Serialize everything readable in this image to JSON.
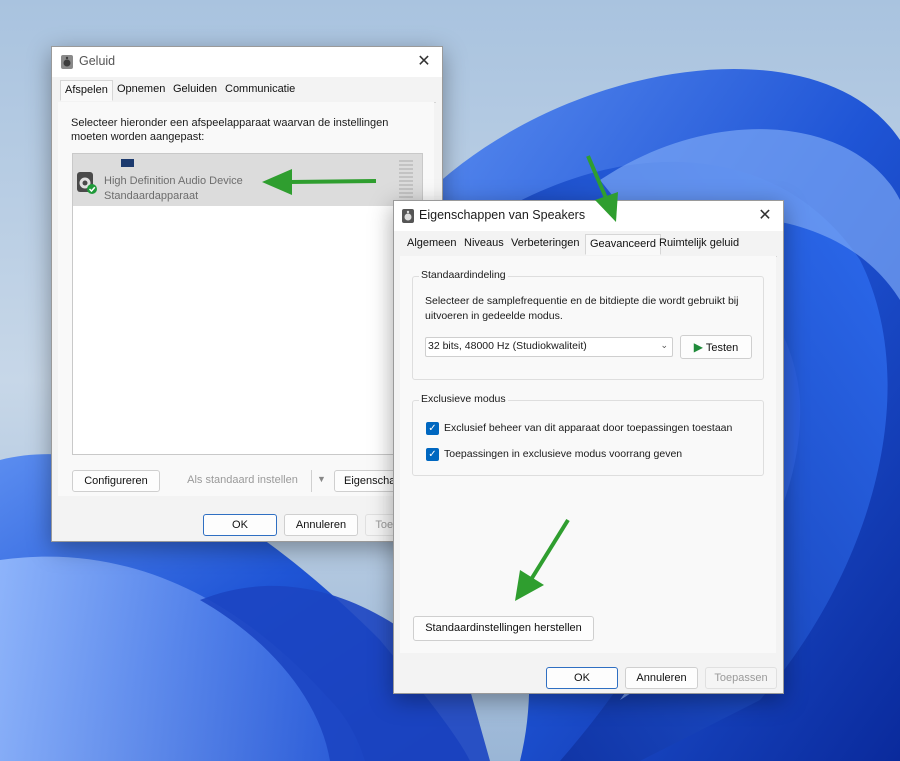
{
  "sound_dialog": {
    "title": "Geluid",
    "tabs": [
      "Afspelen",
      "Opnemen",
      "Geluiden",
      "Communicatie"
    ],
    "instruction": "Selecteer hieronder een afspeelapparaat waarvan de instellingen moeten worden aangepast:",
    "device": {
      "name": "High Definition Audio Device",
      "status": "Standaardapparaat"
    },
    "buttons": {
      "configure": "Configureren",
      "set_default": "Als standaard instellen",
      "properties": "Eigenschappen"
    },
    "footer": {
      "ok": "OK",
      "cancel": "Annuleren",
      "apply": "Toepassen"
    }
  },
  "speaker_dialog": {
    "title": "Eigenschappen van Speakers",
    "tabs": [
      "Algemeen",
      "Niveaus",
      "Verbeteringen",
      "Geavanceerd",
      "Ruimtelijk geluid"
    ],
    "active_tab": "Geavanceerd",
    "default_format": {
      "label": "Standaardindeling",
      "description": "Selecteer de samplefrequentie en de bitdiepte die wordt gebruikt bij uitvoeren in gedeelde modus.",
      "selected": "32 bits, 48000 Hz (Studiokwaliteit)",
      "test_button": "Testen"
    },
    "exclusive_mode": {
      "label": "Exclusieve modus",
      "options": [
        {
          "label": "Exclusief beheer van dit apparaat door toepassingen toestaan",
          "checked": true
        },
        {
          "label": "Toepassingen in exclusieve modus voorrang geven",
          "checked": true
        }
      ]
    },
    "restore_button": "Standaardinstellingen herstellen",
    "footer": {
      "ok": "OK",
      "cancel": "Annuleren",
      "apply": "Toepassen"
    }
  },
  "colors": {
    "accent": "#0067c0",
    "annotation_arrow": "#2f9e2f",
    "wallpaper": "#1a4fd0"
  }
}
